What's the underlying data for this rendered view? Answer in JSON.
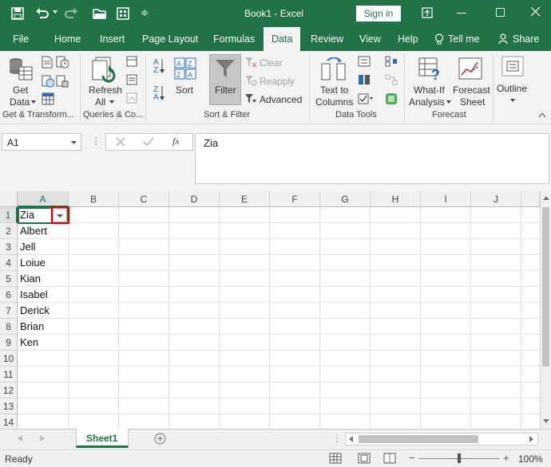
{
  "window": {
    "title": "Book1 - Excel",
    "sign_in": "Sign in"
  },
  "tabs": [
    {
      "label": "File"
    },
    {
      "label": "Home"
    },
    {
      "label": "Insert"
    },
    {
      "label": "Page Layout"
    },
    {
      "label": "Formulas"
    },
    {
      "label": "Data"
    },
    {
      "label": "Review"
    },
    {
      "label": "View"
    },
    {
      "label": "Help"
    },
    {
      "label": "Tell me"
    },
    {
      "label": "Share"
    }
  ],
  "active_tab": "Data",
  "ribbon": {
    "get_data": {
      "line1": "Get",
      "line2": "Data"
    },
    "refresh": {
      "line1": "Refresh",
      "line2": "All"
    },
    "sort": "Sort",
    "filter": "Filter",
    "clear": "Clear",
    "reapply": "Reapply",
    "advanced": "Advanced",
    "text_to_columns": {
      "line1": "Text to",
      "line2": "Columns"
    },
    "what_if": {
      "line1": "What-If",
      "line2": "Analysis"
    },
    "forecast_sheet": {
      "line1": "Forecast",
      "line2": "Sheet"
    },
    "outline": "Outline",
    "groups": {
      "get_transform": "Get & Transform...",
      "queries": "Queries & Co...",
      "sort_filter": "Sort & Filter",
      "data_tools": "Data Tools",
      "forecast": "Forecast"
    }
  },
  "formula_bar": {
    "name_box": "A1",
    "fx": "fx",
    "content": "Zia"
  },
  "columns": [
    "A",
    "B",
    "C",
    "D",
    "E",
    "F",
    "G",
    "H",
    "I",
    "J"
  ],
  "rows": [
    "1",
    "2",
    "3",
    "4",
    "5",
    "6",
    "7",
    "8",
    "9",
    "10",
    "11",
    "12",
    "13",
    "14"
  ],
  "cells_a": [
    "Zia",
    "Albert",
    "Jell",
    "Loiue",
    "Kian",
    "Isabel",
    "Derick",
    "Brian",
    "Ken"
  ],
  "sheet_tab": "Sheet1",
  "status": {
    "ready": "Ready",
    "zoom": "100%"
  },
  "colors": {
    "accent": "#217346",
    "highlight": "#e00000"
  }
}
